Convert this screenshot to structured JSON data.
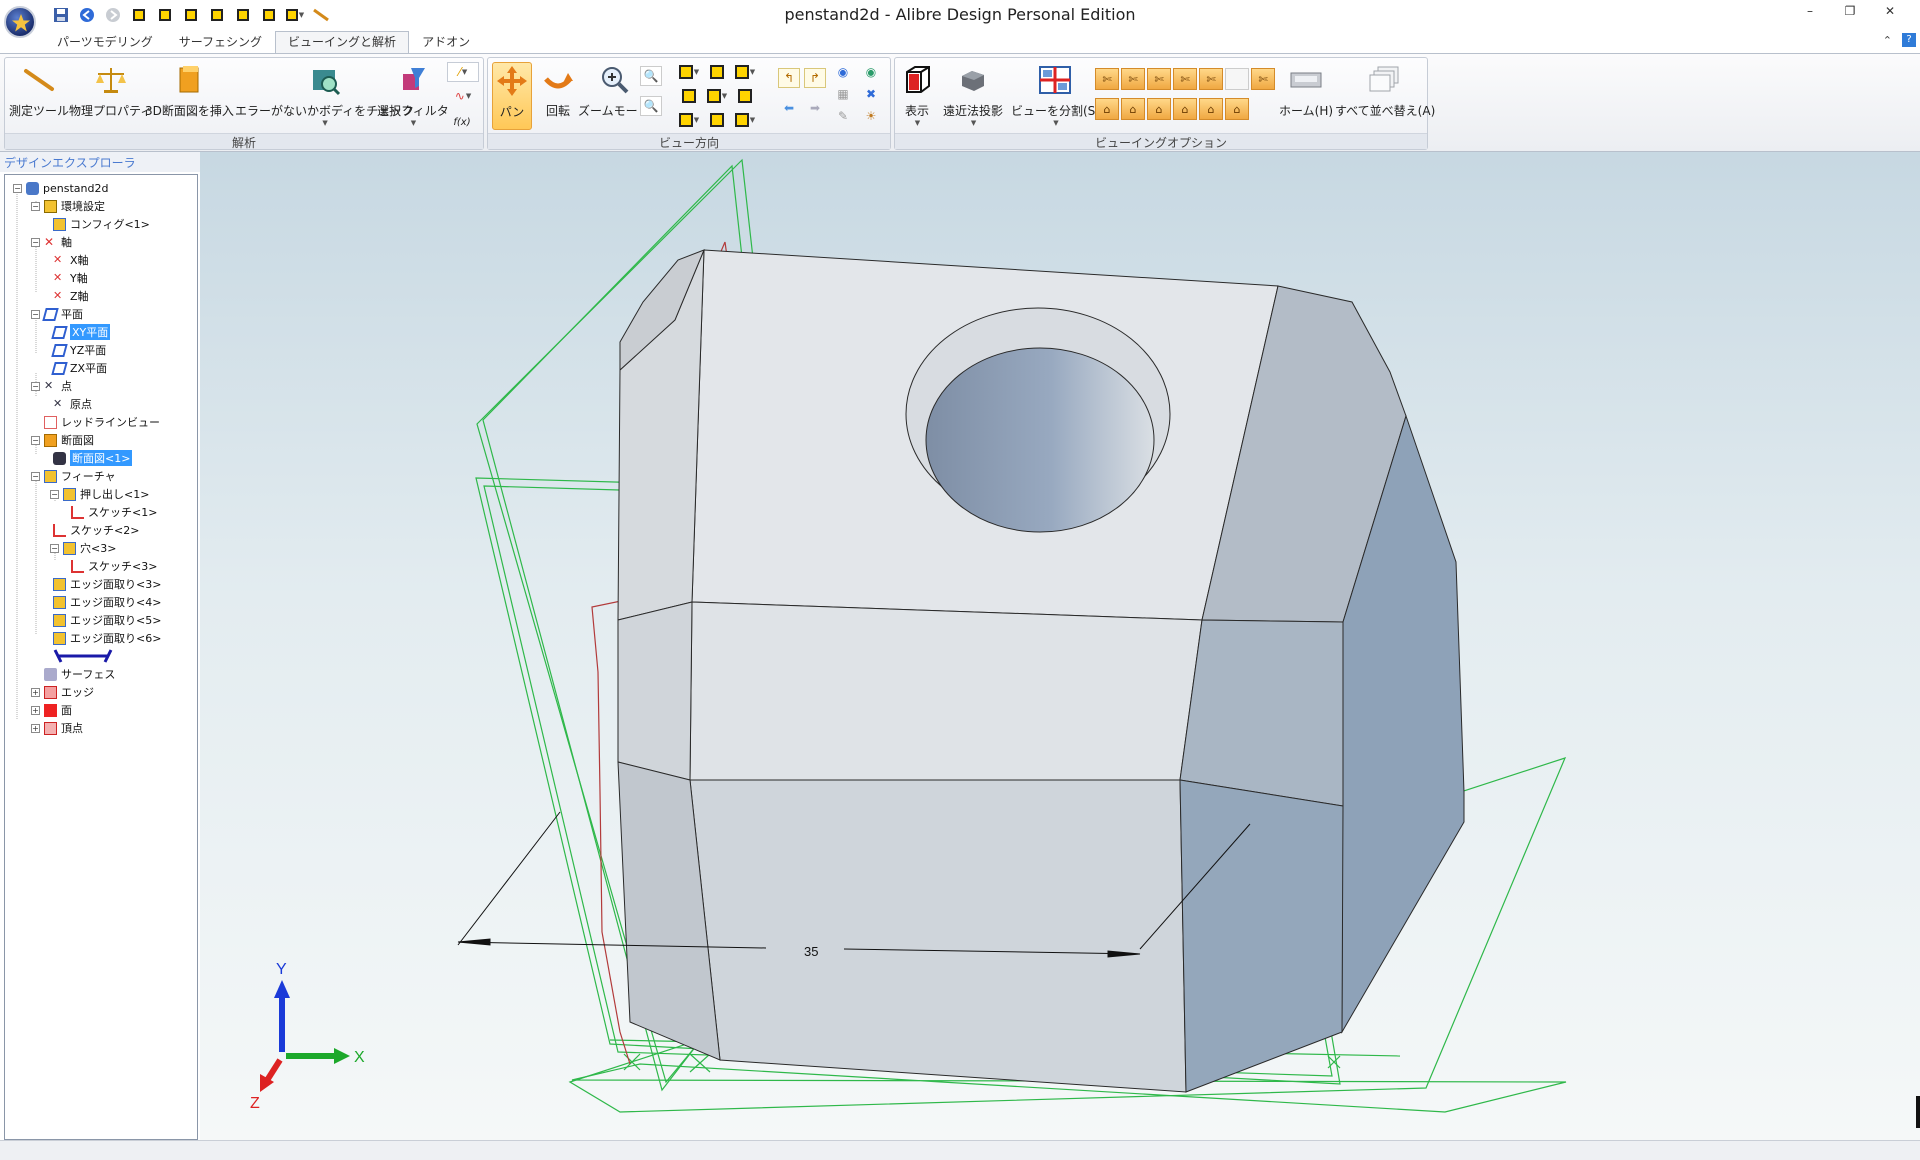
{
  "window": {
    "title": "penstand2d - Alibre Design Personal Edition",
    "minimize": "–",
    "restore": "❐",
    "close": "✕"
  },
  "tabs": [
    {
      "label": "パーツモデリング"
    },
    {
      "label": "サーフェシング"
    },
    {
      "label": "ビューイングと解析"
    },
    {
      "label": "アドオン"
    }
  ],
  "ribbon": {
    "analysis": {
      "label": "解析",
      "measure": "測定ツール",
      "physical": "物理プロパティ",
      "section": "3D断面図を挿入",
      "check": "エラーがないかボディをチェック",
      "filter": "選択フィルタ",
      "fx": "f(x)"
    },
    "view_orientation": {
      "label": "ビュー方向",
      "pan": "パン",
      "rotate": "回転",
      "zoom": "ズームモード"
    },
    "viewing_options": {
      "label": "ビューイングオプション",
      "display": "表示",
      "perspective": "遠近法投影",
      "split": "ビューを分割(S)",
      "home": "ホーム(H)",
      "arrange": "すべて並べ替え(A)"
    }
  },
  "explorer": {
    "title": "デザインエクスプローラ",
    "root": "penstand2d",
    "items": [
      {
        "label": "環境設定"
      },
      {
        "label": "コンフィグ<1>"
      },
      {
        "label": "軸"
      },
      {
        "label": "X軸"
      },
      {
        "label": "Y軸"
      },
      {
        "label": "Z軸"
      },
      {
        "label": "平面"
      },
      {
        "label": "XY平面"
      },
      {
        "label": "YZ平面"
      },
      {
        "label": "ZX平面"
      },
      {
        "label": "点"
      },
      {
        "label": "原点"
      },
      {
        "label": "レッドラインビュー"
      },
      {
        "label": "断面図"
      },
      {
        "label": "断面図<1>"
      },
      {
        "label": "フィーチャ"
      },
      {
        "label": "押し出し<1>"
      },
      {
        "label": "スケッチ<1>"
      },
      {
        "label": "スケッチ<2>"
      },
      {
        "label": "穴<3>"
      },
      {
        "label": "スケッチ<3>"
      },
      {
        "label": "エッジ面取り<3>"
      },
      {
        "label": "エッジ面取り<4>"
      },
      {
        "label": "エッジ面取り<5>"
      },
      {
        "label": "エッジ面取り<6>"
      },
      {
        "label": "サーフェス"
      },
      {
        "label": "エッジ"
      },
      {
        "label": "面"
      },
      {
        "label": "頂点"
      }
    ]
  },
  "viewport": {
    "dimension_value": "35",
    "axes": {
      "y": "Y",
      "x": "X",
      "z": "Z"
    }
  },
  "colors": {
    "accent": "#3399ff",
    "pan_pressed": "#ffc857",
    "plane_green": "#2fb84a",
    "model_face": "#dfe3e8",
    "model_side": "#8ea2b8"
  }
}
